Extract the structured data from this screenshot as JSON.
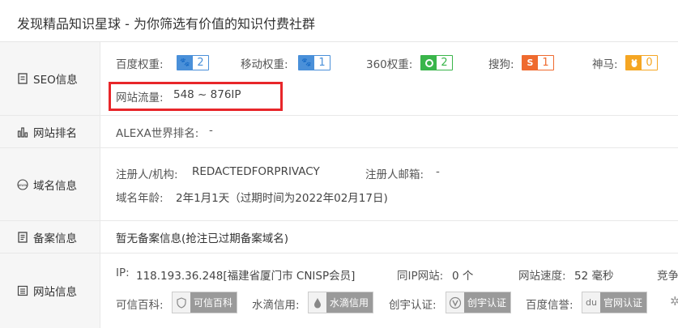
{
  "page_title": "发现精品知识星球 - 为你筛选有价值的知识付费社群",
  "colors": {
    "red_box": "#e8262a",
    "blue": "#4a90d9",
    "green": "#39b54a",
    "orange_red": "#ef6a2e",
    "orange": "#f5a623"
  },
  "seo": {
    "label": "SEO信息",
    "baidu": {
      "label": "百度权重:",
      "value": "2",
      "icon": "paw-icon"
    },
    "mobile": {
      "label": "移动权重:",
      "value": "1",
      "icon": "paw-icon"
    },
    "s360": {
      "label": "360权重:",
      "value": "2",
      "icon": "360-icon"
    },
    "sogou": {
      "label": "搜狗:",
      "value": "1",
      "icon": "sogou-icon"
    },
    "shenma": {
      "label": "神马:",
      "value": "0",
      "icon": "shenma-icon"
    },
    "traffic": {
      "label": "网站流量:",
      "value": "548 ~ 876IP"
    }
  },
  "rank": {
    "label": "网站排名",
    "alexa_label": "ALEXA世界排名:",
    "alexa_value": "-"
  },
  "domain": {
    "label": "域名信息",
    "registrant_label": "注册人/机构:",
    "registrant_value": "REDACTEDFORPRIVACY",
    "email_label": "注册人邮箱:",
    "email_value": "-",
    "age_label": "域名年龄:",
    "age_value": "2年1月1天（过期时间为2022年02月17日)"
  },
  "icp": {
    "label": "备案信息",
    "value": "暂无备案信息(抢注已过期备案域名)"
  },
  "site": {
    "label": "网站信息",
    "ip_label": "IP:",
    "ip_value": "118.193.36.248[福建省厦门市 CNISP会员]",
    "same_ip_label": "同IP网站:",
    "same_ip_value": "0 个",
    "speed_label": "网站速度:",
    "speed_value": "52 毫秒",
    "competitor_label": "竞争",
    "kexin_label": "可信百科:",
    "kexin_badge": "可信百科",
    "shuidi_label": "水滴信用:",
    "shuidi_badge": "水滴信用",
    "chuangyu_label": "创宇认证:",
    "chuangyu_badge": "创宇认证",
    "baidu_credit_label": "百度信誉:",
    "baidu_credit_badge": "官网认证"
  }
}
